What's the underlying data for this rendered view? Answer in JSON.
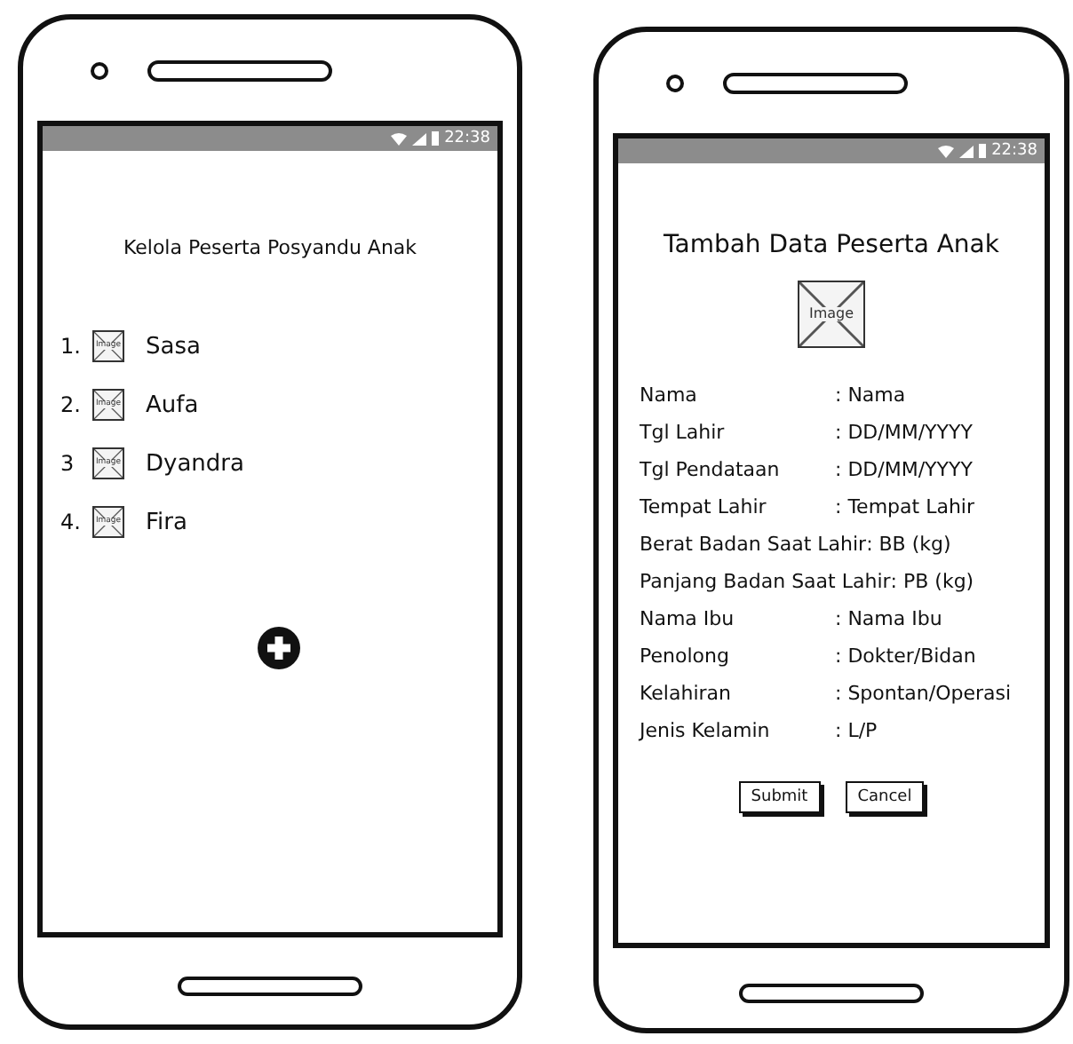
{
  "screens": [
    {
      "kind": "list",
      "status_time": "22:38",
      "title": "Kelola Peserta Posyandu Anak",
      "items": [
        {
          "number": "1.",
          "image_label": "Image",
          "name": "Sasa"
        },
        {
          "number": "2.",
          "image_label": "Image",
          "name": "Aufa"
        },
        {
          "number": "3",
          "image_label": "Image",
          "name": "Dyandra"
        },
        {
          "number": "4.",
          "image_label": "Image",
          "name": "Fira"
        }
      ]
    },
    {
      "kind": "form",
      "status_time": "22:38",
      "title": "Tambah Data Peserta Anak",
      "image_label": "Image",
      "fields": [
        {
          "label": "Nama",
          "value": ": Nama"
        },
        {
          "label": "Tgl Lahir",
          "value": ": DD/MM/YYYY"
        },
        {
          "label": "Tgl Pendataan",
          "value": ": DD/MM/YYYY"
        },
        {
          "label": "Tempat Lahir",
          "value": ": Tempat Lahir"
        },
        {
          "label": "Berat Badan Saat Lahir",
          "value": ": BB (kg)"
        },
        {
          "label": "Panjang Badan Saat Lahir",
          "value": ": PB (kg)"
        },
        {
          "label": "Nama Ibu",
          "value": ": Nama Ibu"
        },
        {
          "label": "Penolong",
          "value": ": Dokter/Bidan"
        },
        {
          "label": "Kelahiran",
          "value": ": Spontan/Operasi"
        },
        {
          "label": "Jenis Kelamin",
          "value": ": L/P"
        }
      ],
      "buttons": [
        "Submit",
        "Cancel"
      ]
    }
  ]
}
